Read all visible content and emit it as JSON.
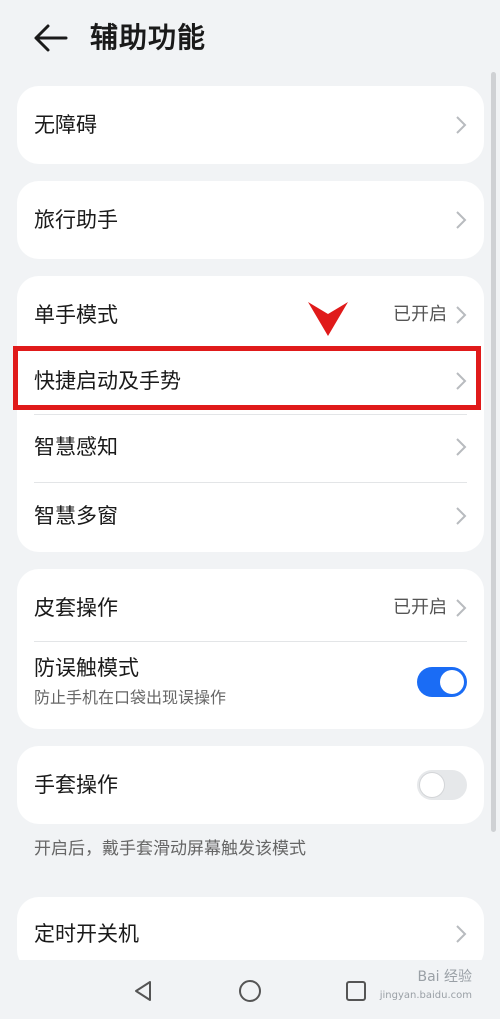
{
  "header": {
    "title": "辅助功能"
  },
  "cards": {
    "accessibility": {
      "label": "无障碍"
    },
    "travel": {
      "label": "旅行助手"
    },
    "group1": {
      "one_hand": {
        "label": "单手模式",
        "status": "已开启"
      },
      "shortcuts": {
        "label": "快捷启动及手势"
      },
      "smart_sense": {
        "label": "智慧感知"
      },
      "smart_window": {
        "label": "智慧多窗"
      }
    },
    "group2": {
      "cover": {
        "label": "皮套操作",
        "status": "已开启"
      },
      "mistouch": {
        "label": "防误触模式",
        "sub": "防止手机在口袋出现误操作",
        "toggle_on": true
      }
    },
    "glove": {
      "label": "手套操作",
      "toggle_on": false,
      "hint": "开启后，戴手套滑动屏幕触发该模式"
    },
    "timer": {
      "label": "定时开关机"
    }
  },
  "watermark": {
    "text": "Bai 经验",
    "url": "jingyan.baidu.com"
  },
  "colors": {
    "accent": "#1a6cf5",
    "annotation": "#e01a1a",
    "background": "#f1f3f5"
  }
}
